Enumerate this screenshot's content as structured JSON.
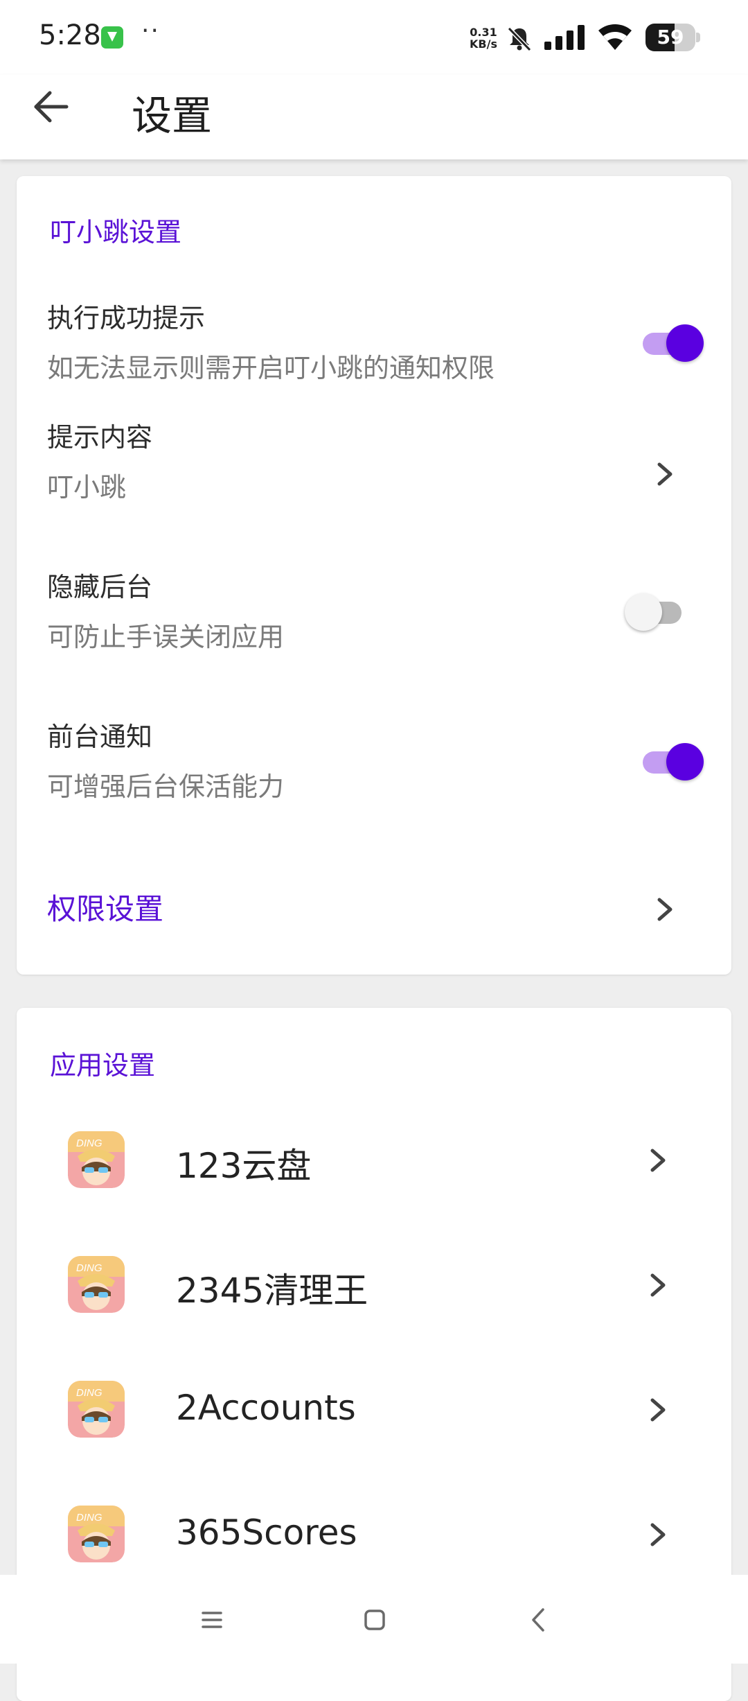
{
  "status_bar": {
    "time": "5:28",
    "dots": "··",
    "speed_value": "0.31",
    "speed_unit": "KB/s",
    "battery": "59",
    "battery_level_percent": 59,
    "app_icon": "green-shield-icon"
  },
  "header": {
    "title": "设置",
    "back_icon": "arrow-left-icon"
  },
  "ding_section": {
    "title": "叮小跳设置",
    "items": [
      {
        "title": "执行成功提示",
        "subtitle": "如无法显示则需开启叮小跳的通知权限",
        "control": "toggle",
        "checked": true
      },
      {
        "title": "提示内容",
        "subtitle": "叮小跳",
        "control": "chevron"
      },
      {
        "title": "隐藏后台",
        "subtitle": "可防止手误关闭应用",
        "control": "toggle",
        "checked": false
      },
      {
        "title": "前台通知",
        "subtitle": "可增强后台保活能力",
        "control": "toggle",
        "checked": true
      }
    ],
    "permission_label": "权限设置"
  },
  "app_section": {
    "title": "应用设置",
    "apps": [
      {
        "name": "123云盘",
        "icon": "ding-app-icon"
      },
      {
        "name": "2345清理王",
        "icon": "ding-app-icon"
      },
      {
        "name": "2Accounts",
        "icon": "ding-app-icon"
      },
      {
        "name": "365Scores",
        "icon": "ding-app-icon"
      }
    ]
  },
  "nav_bar": {
    "menu_icon": "menu-icon",
    "home_icon": "home-square-icon",
    "back_icon": "back-chevron-icon"
  },
  "colors": {
    "accent": "#5a00e0",
    "section_title": "#5a12d6",
    "toggle_track_on": "#c39df2",
    "toggle_track_off": "#b9b9b9",
    "background": "#eeeeee"
  }
}
